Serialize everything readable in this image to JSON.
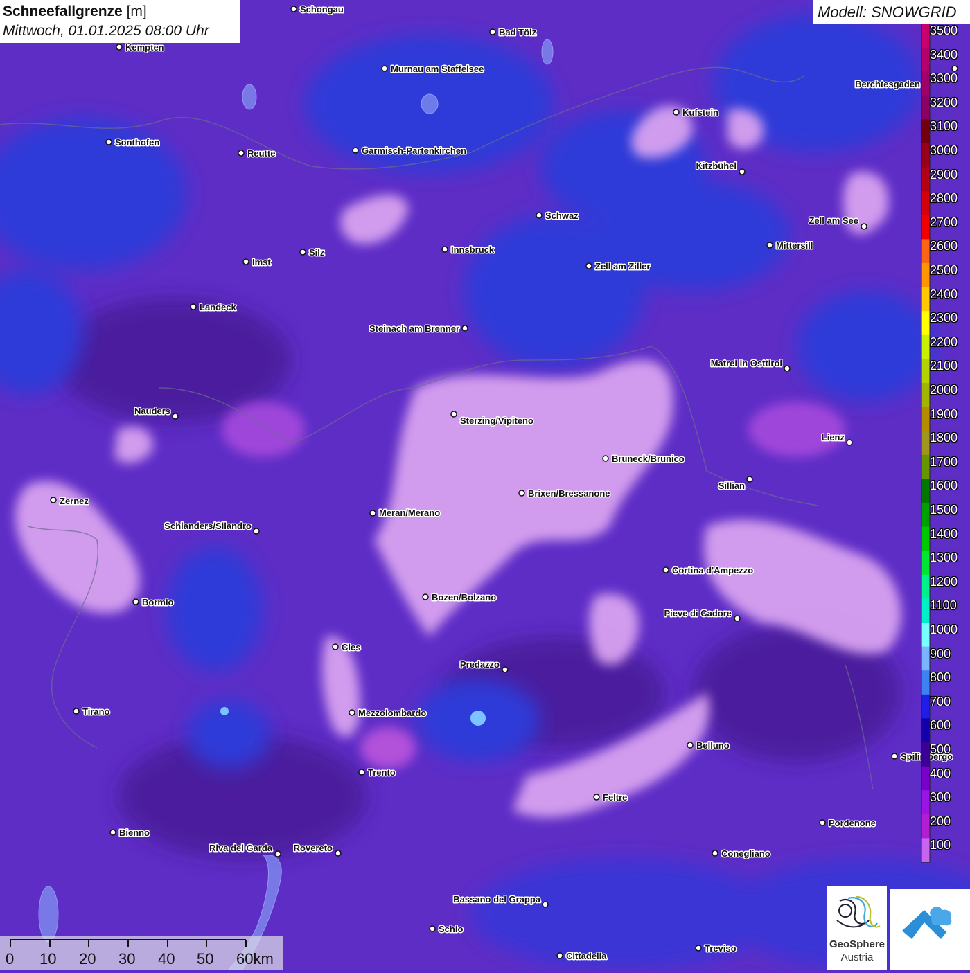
{
  "header": {
    "title": "Schneefallgrenze",
    "unit": "[m]",
    "datetime": "Mittwoch, 01.01.2025 08:00 Uhr"
  },
  "model": {
    "label": "Modell: SNOWGRID"
  },
  "legend": {
    "values": [
      "3500",
      "3400",
      "3300",
      "3200",
      "3100",
      "3000",
      "2900",
      "2800",
      "2700",
      "2600",
      "2500",
      "2400",
      "2300",
      "2200",
      "2100",
      "2000",
      "1900",
      "1800",
      "1700",
      "1600",
      "1500",
      "1400",
      "1300",
      "1200",
      "1100",
      "1000",
      "900",
      "800",
      "700",
      "600",
      "500",
      "400",
      "300",
      "200",
      "100"
    ],
    "colors": [
      "#c8006e",
      "#b4006a",
      "#a0006a",
      "#8c0064",
      "#700010",
      "#960018",
      "#b40014",
      "#d2000a",
      "#f00000",
      "#ff6414",
      "#ff9600",
      "#ffc800",
      "#ffff00",
      "#c8f000",
      "#b4d200",
      "#a0b400",
      "#b48c00",
      "#a0961e",
      "#649600",
      "#007800",
      "#00a000",
      "#00c800",
      "#00e632",
      "#00f08c",
      "#00f0c8",
      "#78ffff",
      "#78b4ff",
      "#3c82f0",
      "#1e1ee6",
      "#1400aa",
      "#3c0096",
      "#7800c8",
      "#9b14e6",
      "#b41ed2",
      "#c864f0"
    ]
  },
  "cities": [
    {
      "name": "Schongau"
    },
    {
      "name": "Bad Tölz"
    },
    {
      "name": "Kempten"
    },
    {
      "name": "Murnau am Staffelsee"
    },
    {
      "name": "Berchtesgaden"
    },
    {
      "name": "Kufstein"
    },
    {
      "name": "Sonthofen"
    },
    {
      "name": "Reutte"
    },
    {
      "name": "Garmisch-Partenkirchen"
    },
    {
      "name": "Kitzbühel"
    },
    {
      "name": "Schwaz"
    },
    {
      "name": "Zell am See"
    },
    {
      "name": "Innsbruck"
    },
    {
      "name": "Mittersill"
    },
    {
      "name": "Imst"
    },
    {
      "name": "Silz"
    },
    {
      "name": "Zell am Ziller"
    },
    {
      "name": "Landeck"
    },
    {
      "name": "Steinach am Brenner"
    },
    {
      "name": "Matrei in Osttirol"
    },
    {
      "name": "Nauders"
    },
    {
      "name": "Sterzing/Vipiteno"
    },
    {
      "name": "Lienz"
    },
    {
      "name": "Bruneck/Brunico"
    },
    {
      "name": "Sillian"
    },
    {
      "name": "Zernez"
    },
    {
      "name": "Brixen/Bressanone"
    },
    {
      "name": "Meran/Merano"
    },
    {
      "name": "Schlanders/Silandro"
    },
    {
      "name": "Cortina d'Ampezzo"
    },
    {
      "name": "Bormio"
    },
    {
      "name": "Bozen/Bolzano"
    },
    {
      "name": "Pieve di Cadore"
    },
    {
      "name": "Cles"
    },
    {
      "name": "Predazzo"
    },
    {
      "name": "Tirano"
    },
    {
      "name": "Mezzolombardo"
    },
    {
      "name": "Belluno"
    },
    {
      "name": "Spilimbergo"
    },
    {
      "name": "Trento"
    },
    {
      "name": "Feltre"
    },
    {
      "name": "Pordenone"
    },
    {
      "name": "Bienno"
    },
    {
      "name": "Riva del Garda"
    },
    {
      "name": "Rovereto"
    },
    {
      "name": "Conegliano"
    },
    {
      "name": "Bassano del Grappa"
    },
    {
      "name": "Schio"
    },
    {
      "name": "Treviso"
    },
    {
      "name": "Cittadella"
    }
  ],
  "scale_bar": {
    "labels": [
      "0",
      "10",
      "20",
      "30",
      "40",
      "50",
      "60km"
    ]
  },
  "logos": {
    "geosphere_line1": "GeoSphere",
    "geosphere_line2": "Austria"
  }
}
